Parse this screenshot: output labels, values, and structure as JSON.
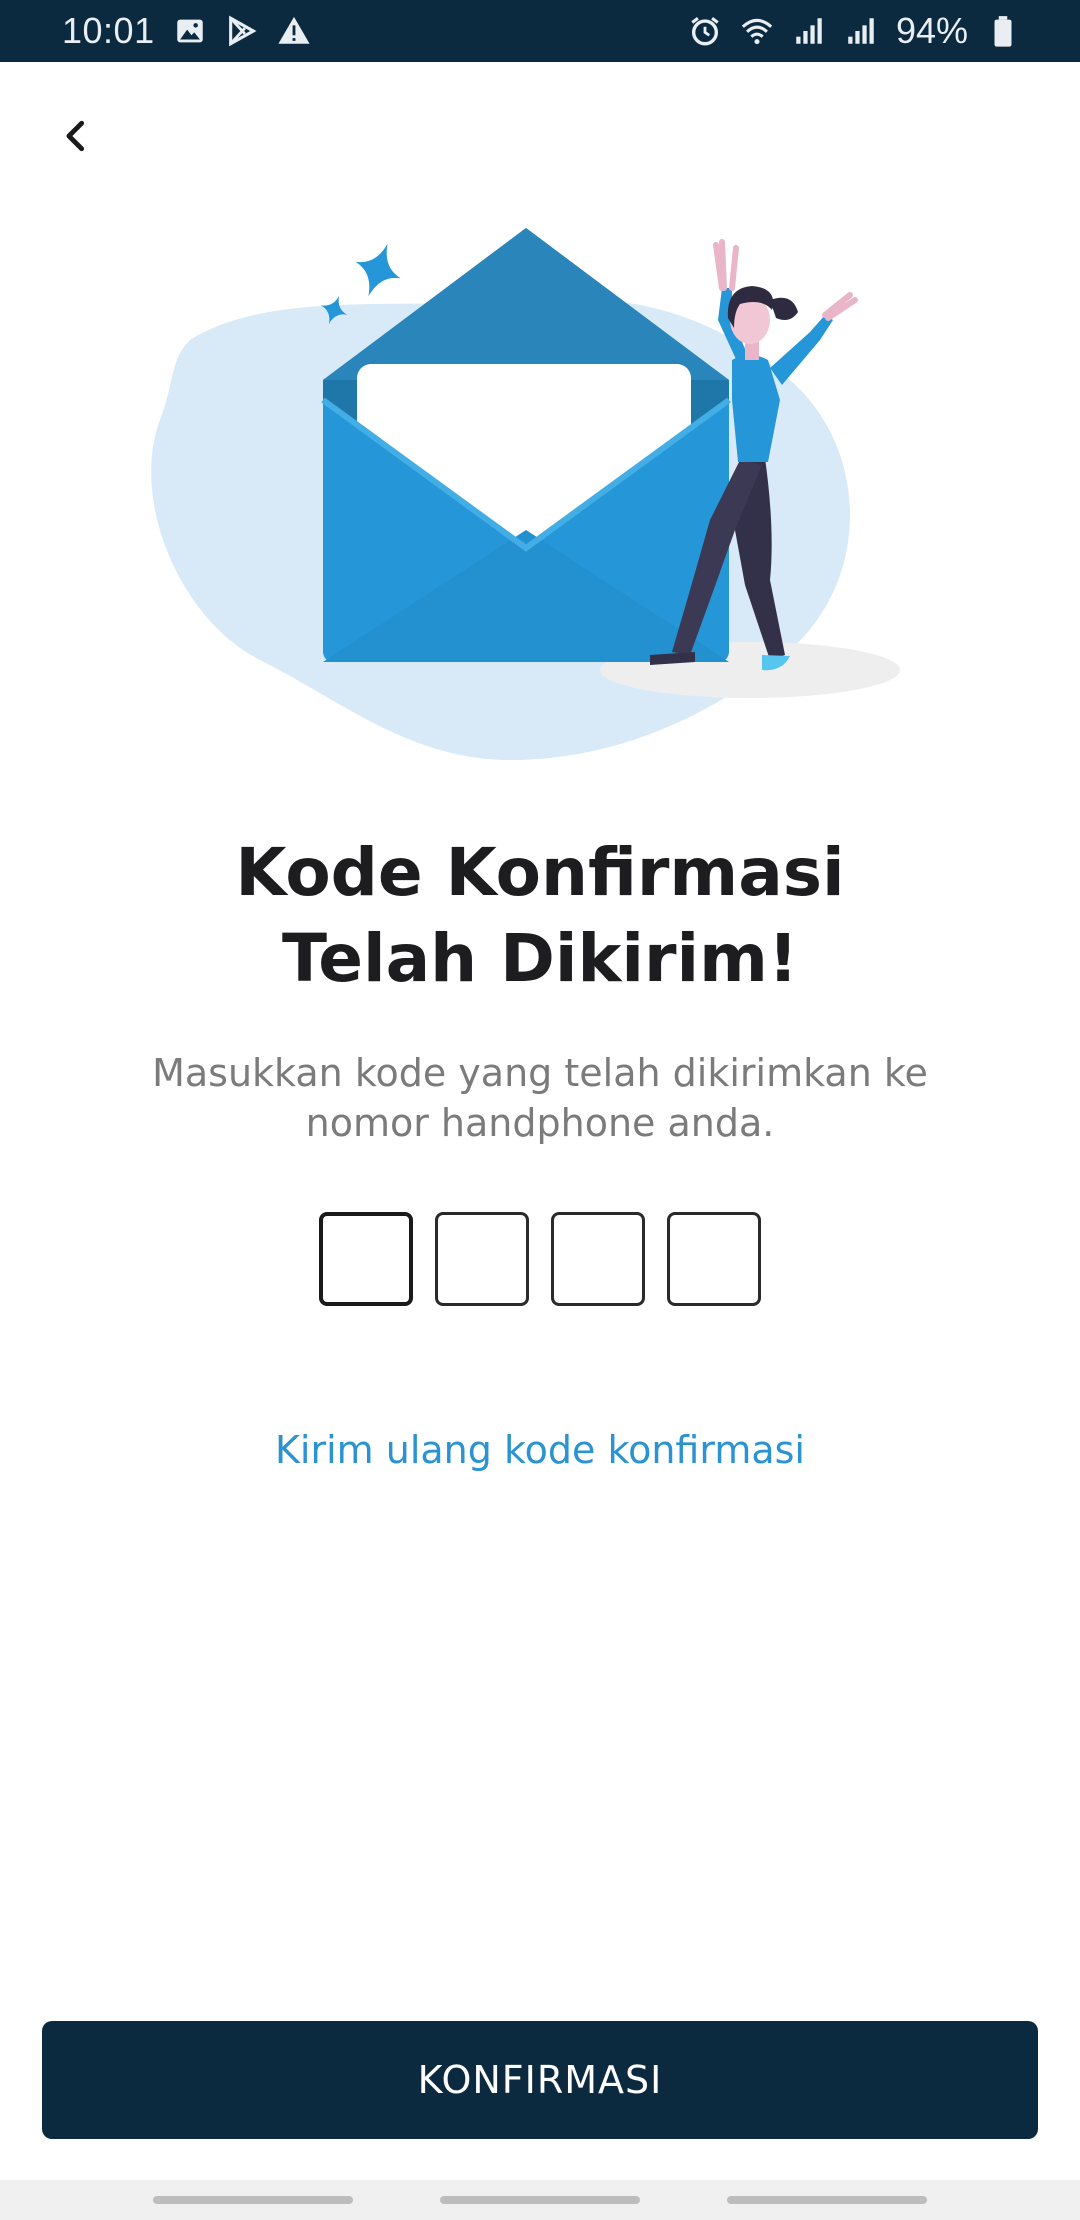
{
  "status_bar": {
    "time": "10:01",
    "battery_text": "94%",
    "left_icons": [
      "gallery-icon",
      "play-store-icon",
      "warning-icon"
    ],
    "right_icons": [
      "alarm-icon",
      "wifi-icon",
      "signal-icon",
      "signal-icon",
      "battery-icon"
    ]
  },
  "header": {
    "back_icon": "chevron-left-icon"
  },
  "illustration": {
    "description_icon": "envelope-celebration-illustration"
  },
  "content": {
    "title_line1": "Kode Konfirmasi",
    "title_line2": "Telah Dikirim!",
    "subtitle": "Masukkan kode yang telah dikirimkan ke nomor handphone anda.",
    "code_boxes": [
      "",
      "",
      "",
      ""
    ],
    "resend_label": "Kirim ulang kode konfirmasi"
  },
  "footer": {
    "confirm_label": "KONFIRMASI"
  },
  "colors": {
    "primary_dark": "#0b2a3f",
    "link_blue": "#2b93d1",
    "envelope_blue": "#2597d8"
  }
}
